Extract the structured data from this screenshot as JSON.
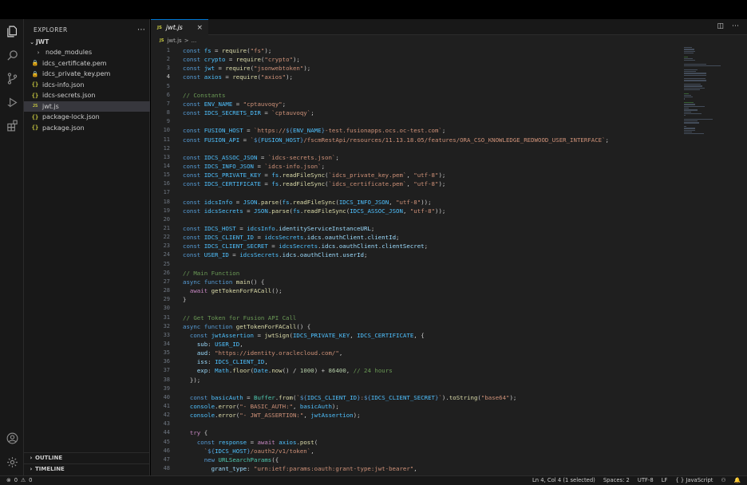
{
  "sidebar": {
    "title": "EXPLORER",
    "folder": "JWT",
    "items": [
      {
        "label": "node_modules",
        "icon": "chevron-right-icon"
      },
      {
        "label": "idcs_certificate.pem",
        "icon": "lock-icon"
      },
      {
        "label": "idcs_private_key.pem",
        "icon": "lock-icon"
      },
      {
        "label": "idcs-info.json",
        "icon": "json-icon"
      },
      {
        "label": "idcs-secrets.json",
        "icon": "json-icon"
      },
      {
        "label": "jwt.js",
        "icon": "js-icon"
      },
      {
        "label": "package-lock.json",
        "icon": "json-icon"
      },
      {
        "label": "package.json",
        "icon": "json-icon"
      }
    ],
    "outline": "OUTLINE",
    "timeline": "TIMELINE"
  },
  "tab": {
    "badge": "JS",
    "name": "jwt.js",
    "close": "×"
  },
  "breadcrumb": {
    "badge": "JS",
    "file": "jwt.js",
    "sep": ">",
    "rest": "..."
  },
  "status": {
    "errors": "0",
    "warnings": "0",
    "position": "Ln 4, Col 4 (1 selected)",
    "spaces": "Spaces: 2",
    "encoding": "UTF-8",
    "eol": "LF",
    "language": "{ } JavaScript"
  },
  "code": {
    "active_line": 4,
    "line_numbers": [
      "1",
      "2",
      "3",
      "4",
      "5",
      "6",
      "7",
      "8",
      "9",
      "10",
      "11",
      "12",
      "13",
      "14",
      "15",
      "16",
      "17",
      "18",
      "19",
      "20",
      "21",
      "22",
      "23",
      "24",
      "25",
      "26",
      "27",
      "28",
      "29",
      "30",
      "31",
      "32",
      "33",
      "34",
      "35",
      "36",
      "37",
      "38",
      "39",
      "40",
      "41",
      "42",
      "43",
      "44",
      "45",
      "46",
      "47",
      "48"
    ],
    "lines": [
      [
        [
          "kw",
          "const "
        ],
        [
          "vr",
          "fs"
        ],
        [
          "pn",
          " = "
        ],
        [
          "fn",
          "require"
        ],
        [
          "pn",
          "("
        ],
        [
          "st",
          "\"fs\""
        ],
        [
          "pn",
          ");"
        ]
      ],
      [
        [
          "kw",
          "const "
        ],
        [
          "vr",
          "crypto"
        ],
        [
          "pn",
          " = "
        ],
        [
          "fn",
          "require"
        ],
        [
          "pn",
          "("
        ],
        [
          "st",
          "\"crypto\""
        ],
        [
          "pn",
          ");"
        ]
      ],
      [
        [
          "kw",
          "const "
        ],
        [
          "vr",
          "jwt"
        ],
        [
          "pn",
          " = "
        ],
        [
          "fn",
          "require"
        ],
        [
          "pn",
          "("
        ],
        [
          "st",
          "\"jsonwebtoken\""
        ],
        [
          "pn",
          ");"
        ]
      ],
      [
        [
          "kw",
          "const "
        ],
        [
          "vr",
          "axios"
        ],
        [
          "pn",
          " = "
        ],
        [
          "fn",
          "require"
        ],
        [
          "pn",
          "("
        ],
        [
          "st",
          "\"axios\""
        ],
        [
          "pn",
          ");"
        ]
      ],
      [],
      [
        [
          "cm",
          "// Constants"
        ]
      ],
      [
        [
          "kw",
          "const "
        ],
        [
          "vr",
          "ENV_NAME"
        ],
        [
          "pn",
          " = "
        ],
        [
          "st",
          "\"cptauvoqy\""
        ],
        [
          "pn",
          ";"
        ]
      ],
      [
        [
          "kw",
          "const "
        ],
        [
          "vr",
          "IDCS_SECRETS_DIR"
        ],
        [
          "pn",
          " = "
        ],
        [
          "st",
          "`cptauvoqy`"
        ],
        [
          "pn",
          ";"
        ]
      ],
      [],
      [
        [
          "kw",
          "const "
        ],
        [
          "vr",
          "FUSION_HOST"
        ],
        [
          "pn",
          " = "
        ],
        [
          "st",
          "`https://"
        ],
        [
          "tp",
          "${"
        ],
        [
          "vr",
          "ENV_NAME"
        ],
        [
          "tp",
          "}"
        ],
        [
          "st",
          "-test.fusionapps.ocs.oc-test.com`"
        ],
        [
          "pn",
          ";"
        ]
      ],
      [
        [
          "kw",
          "const "
        ],
        [
          "vr",
          "FUSION_API"
        ],
        [
          "pn",
          " = "
        ],
        [
          "st",
          "`"
        ],
        [
          "tp",
          "${"
        ],
        [
          "vr",
          "FUSION_HOST"
        ],
        [
          "tp",
          "}"
        ],
        [
          "st",
          "/fscmRestApi/resources/11.13.18.05/features/ORA_CSO_KNOWLEDGE_REDWOOD_USER_INTERFACE`"
        ],
        [
          "pn",
          ";"
        ]
      ],
      [],
      [
        [
          "kw",
          "const "
        ],
        [
          "vr",
          "IDCS_ASSOC_JSON"
        ],
        [
          "pn",
          " = "
        ],
        [
          "st",
          "`idcs-secrets.json`"
        ],
        [
          "pn",
          ";"
        ]
      ],
      [
        [
          "kw",
          "const "
        ],
        [
          "vr",
          "IDCS_INFO_JSON"
        ],
        [
          "pn",
          " = "
        ],
        [
          "st",
          "`idcs-info.json`"
        ],
        [
          "pn",
          ";"
        ]
      ],
      [
        [
          "kw",
          "const "
        ],
        [
          "vr",
          "IDCS_PRIVATE_KEY"
        ],
        [
          "pn",
          " = "
        ],
        [
          "vr",
          "fs"
        ],
        [
          "pn",
          "."
        ],
        [
          "fn",
          "readFileSync"
        ],
        [
          "pn",
          "("
        ],
        [
          "st",
          "`idcs_private_key.pem`"
        ],
        [
          "pn",
          ", "
        ],
        [
          "st",
          "\"utf-8\""
        ],
        [
          "pn",
          ");"
        ]
      ],
      [
        [
          "kw",
          "const "
        ],
        [
          "vr",
          "IDCS_CERTIFICATE"
        ],
        [
          "pn",
          " = "
        ],
        [
          "vr",
          "fs"
        ],
        [
          "pn",
          "."
        ],
        [
          "fn",
          "readFileSync"
        ],
        [
          "pn",
          "("
        ],
        [
          "st",
          "`idcs_certificate.pem`"
        ],
        [
          "pn",
          ", "
        ],
        [
          "st",
          "\"utf-8\""
        ],
        [
          "pn",
          ");"
        ]
      ],
      [],
      [
        [
          "kw",
          "const "
        ],
        [
          "vr",
          "idcsInfo"
        ],
        [
          "pn",
          " = "
        ],
        [
          "vr",
          "JSON"
        ],
        [
          "pn",
          "."
        ],
        [
          "fn",
          "parse"
        ],
        [
          "pn",
          "("
        ],
        [
          "vr",
          "fs"
        ],
        [
          "pn",
          "."
        ],
        [
          "fn",
          "readFileSync"
        ],
        [
          "pn",
          "("
        ],
        [
          "vr",
          "IDCS_INFO_JSON"
        ],
        [
          "pn",
          ", "
        ],
        [
          "st",
          "\"utf-8\""
        ],
        [
          "pn",
          "));"
        ]
      ],
      [
        [
          "kw",
          "const "
        ],
        [
          "vr",
          "idcsSecrets"
        ],
        [
          "pn",
          " = "
        ],
        [
          "vr",
          "JSON"
        ],
        [
          "pn",
          "."
        ],
        [
          "fn",
          "parse"
        ],
        [
          "pn",
          "("
        ],
        [
          "vr",
          "fs"
        ],
        [
          "pn",
          "."
        ],
        [
          "fn",
          "readFileSync"
        ],
        [
          "pn",
          "("
        ],
        [
          "vr",
          "IDCS_ASSOC_JSON"
        ],
        [
          "pn",
          ", "
        ],
        [
          "st",
          "\"utf-8\""
        ],
        [
          "pn",
          "));"
        ]
      ],
      [],
      [
        [
          "kw",
          "const "
        ],
        [
          "vr",
          "IDCS_HOST"
        ],
        [
          "pn",
          " = "
        ],
        [
          "vr",
          "idcsInfo"
        ],
        [
          "pn",
          "."
        ],
        [
          "pr",
          "identityServiceInstanceURL"
        ],
        [
          "pn",
          ";"
        ]
      ],
      [
        [
          "kw",
          "const "
        ],
        [
          "vr",
          "IDCS_CLIENT_ID"
        ],
        [
          "pn",
          " = "
        ],
        [
          "vr",
          "idcsSecrets"
        ],
        [
          "pn",
          "."
        ],
        [
          "pr",
          "idcs"
        ],
        [
          "pn",
          "."
        ],
        [
          "pr",
          "oauthClient"
        ],
        [
          "pn",
          "."
        ],
        [
          "pr",
          "clientId"
        ],
        [
          "pn",
          ";"
        ]
      ],
      [
        [
          "kw",
          "const "
        ],
        [
          "vr",
          "IDCS_CLIENT_SECRET"
        ],
        [
          "pn",
          " = "
        ],
        [
          "vr",
          "idcsSecrets"
        ],
        [
          "pn",
          "."
        ],
        [
          "pr",
          "idcs"
        ],
        [
          "pn",
          "."
        ],
        [
          "pr",
          "oauthClient"
        ],
        [
          "pn",
          "."
        ],
        [
          "pr",
          "clientSecret"
        ],
        [
          "pn",
          ";"
        ]
      ],
      [
        [
          "kw",
          "const "
        ],
        [
          "vr",
          "USER_ID"
        ],
        [
          "pn",
          " = "
        ],
        [
          "vr",
          "idcsSecrets"
        ],
        [
          "pn",
          "."
        ],
        [
          "pr",
          "idcs"
        ],
        [
          "pn",
          "."
        ],
        [
          "pr",
          "oauthClient"
        ],
        [
          "pn",
          "."
        ],
        [
          "pr",
          "userId"
        ],
        [
          "pn",
          ";"
        ]
      ],
      [],
      [
        [
          "cm",
          "// Main Function"
        ]
      ],
      [
        [
          "kw",
          "async function "
        ],
        [
          "fn",
          "main"
        ],
        [
          "pn",
          "() {"
        ]
      ],
      [
        [
          "pn",
          "  "
        ],
        [
          "kw2",
          "await "
        ],
        [
          "fn",
          "getTokenForFACall"
        ],
        [
          "pn",
          "();"
        ]
      ],
      [
        [
          "pn",
          "}"
        ]
      ],
      [],
      [
        [
          "cm",
          "// Get Token for Fusion API Call"
        ]
      ],
      [
        [
          "kw",
          "async function "
        ],
        [
          "fn",
          "getTokenForFACall"
        ],
        [
          "pn",
          "() {"
        ]
      ],
      [
        [
          "pn",
          "  "
        ],
        [
          "kw",
          "const "
        ],
        [
          "vr",
          "jwtAssertion"
        ],
        [
          "pn",
          " = "
        ],
        [
          "fn",
          "jwtSign"
        ],
        [
          "pn",
          "("
        ],
        [
          "vr",
          "IDCS_PRIVATE_KEY"
        ],
        [
          "pn",
          ", "
        ],
        [
          "vr",
          "IDCS_CERTIFICATE"
        ],
        [
          "pn",
          ", {"
        ]
      ],
      [
        [
          "pn",
          "    "
        ],
        [
          "pr",
          "sub"
        ],
        [
          "pn",
          ": "
        ],
        [
          "vr",
          "USER_ID"
        ],
        [
          "pn",
          ","
        ]
      ],
      [
        [
          "pn",
          "    "
        ],
        [
          "pr",
          "aud"
        ],
        [
          "pn",
          ": "
        ],
        [
          "st",
          "\"https://identity.oraclecloud.com/\""
        ],
        [
          "pn",
          ","
        ]
      ],
      [
        [
          "pn",
          "    "
        ],
        [
          "pr",
          "iss"
        ],
        [
          "pn",
          ": "
        ],
        [
          "vr",
          "IDCS_CLIENT_ID"
        ],
        [
          "pn",
          ","
        ]
      ],
      [
        [
          "pn",
          "    "
        ],
        [
          "pr",
          "exp"
        ],
        [
          "pn",
          ": "
        ],
        [
          "vr",
          "Math"
        ],
        [
          "pn",
          "."
        ],
        [
          "fn",
          "floor"
        ],
        [
          "pn",
          "("
        ],
        [
          "vr",
          "Date"
        ],
        [
          "pn",
          "."
        ],
        [
          "fn",
          "now"
        ],
        [
          "pn",
          "() / "
        ],
        [
          "nm",
          "1000"
        ],
        [
          "pn",
          ") + "
        ],
        [
          "nm",
          "86400"
        ],
        [
          "pn",
          ", "
        ],
        [
          "cm",
          "// 24 hours"
        ]
      ],
      [
        [
          "pn",
          "  });"
        ]
      ],
      [],
      [
        [
          "pn",
          "  "
        ],
        [
          "kw",
          "const "
        ],
        [
          "vr",
          "basicAuth"
        ],
        [
          "pn",
          " = "
        ],
        [
          "ty",
          "Buffer"
        ],
        [
          "pn",
          "."
        ],
        [
          "fn",
          "from"
        ],
        [
          "pn",
          "("
        ],
        [
          "st",
          "`"
        ],
        [
          "tp",
          "${"
        ],
        [
          "vr",
          "IDCS_CLIENT_ID"
        ],
        [
          "tp",
          "}"
        ],
        [
          "st",
          ":"
        ],
        [
          "tp",
          "${"
        ],
        [
          "vr",
          "IDCS_CLIENT_SECRET"
        ],
        [
          "tp",
          "}"
        ],
        [
          "st",
          "`"
        ],
        [
          "pn",
          ")."
        ],
        [
          "fn",
          "toString"
        ],
        [
          "pn",
          "("
        ],
        [
          "st",
          "\"base64\""
        ],
        [
          "pn",
          ");"
        ]
      ],
      [
        [
          "pn",
          "  "
        ],
        [
          "vr",
          "console"
        ],
        [
          "pn",
          "."
        ],
        [
          "fn",
          "error"
        ],
        [
          "pn",
          "("
        ],
        [
          "st",
          "\"- BASIC_AUTH:\""
        ],
        [
          "pn",
          ", "
        ],
        [
          "vr",
          "basicAuth"
        ],
        [
          "pn",
          ");"
        ]
      ],
      [
        [
          "pn",
          "  "
        ],
        [
          "vr",
          "console"
        ],
        [
          "pn",
          "."
        ],
        [
          "fn",
          "error"
        ],
        [
          "pn",
          "("
        ],
        [
          "st",
          "\"- JWT_ASSERTION:\""
        ],
        [
          "pn",
          ", "
        ],
        [
          "vr",
          "jwtAssertion"
        ],
        [
          "pn",
          ");"
        ]
      ],
      [],
      [
        [
          "pn",
          "  "
        ],
        [
          "kw2",
          "try "
        ],
        [
          "pn",
          "{"
        ]
      ],
      [
        [
          "pn",
          "    "
        ],
        [
          "kw",
          "const "
        ],
        [
          "vr",
          "response"
        ],
        [
          "pn",
          " = "
        ],
        [
          "kw2",
          "await "
        ],
        [
          "vr",
          "axios"
        ],
        [
          "pn",
          "."
        ],
        [
          "fn",
          "post"
        ],
        [
          "pn",
          "("
        ]
      ],
      [
        [
          "pn",
          "      "
        ],
        [
          "st",
          "`"
        ],
        [
          "tp",
          "${"
        ],
        [
          "vr",
          "IDCS_HOST"
        ],
        [
          "tp",
          "}"
        ],
        [
          "st",
          "/oauth2/v1/token`"
        ],
        [
          "pn",
          ","
        ]
      ],
      [
        [
          "pn",
          "      "
        ],
        [
          "kw",
          "new "
        ],
        [
          "ty",
          "URLSearchParams"
        ],
        [
          "pn",
          "({"
        ]
      ],
      [
        [
          "pn",
          "        "
        ],
        [
          "pr",
          "grant_type"
        ],
        [
          "pn",
          ": "
        ],
        [
          "st",
          "\"urn:ietf:params:oauth:grant-type:jwt-bearer\""
        ],
        [
          "pn",
          ","
        ]
      ]
    ]
  }
}
